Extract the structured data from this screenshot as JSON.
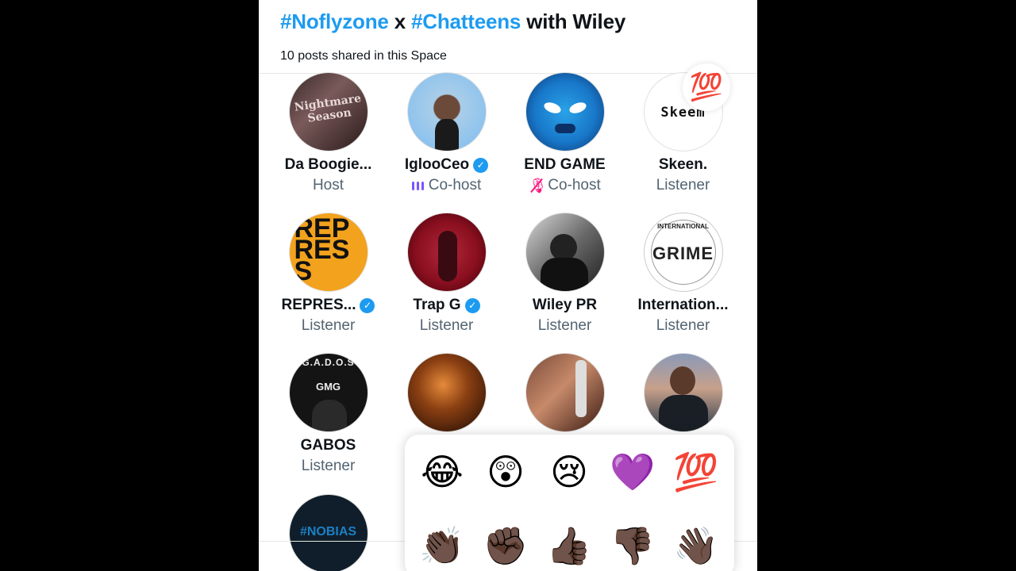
{
  "space": {
    "title_parts": [
      "#Noflyzone",
      " x ",
      "#Chatteens",
      " with Wiley"
    ],
    "subtitle": "10 posts shared in this Space"
  },
  "participants": [
    {
      "name": "Da Boogie...",
      "role": "Host",
      "verified": false,
      "avatar_text": "Nightmare Season"
    },
    {
      "name": "IglooCeo",
      "role": "Co-host",
      "verified": true,
      "status": "speaking"
    },
    {
      "name": "END GAME",
      "role": "Co-host",
      "verified": false,
      "status": "muted"
    },
    {
      "name": "Skeen.",
      "role": "Listener",
      "verified": false,
      "avatar_text": "Skeem"
    },
    {
      "name": "REPRES...",
      "role": "Listener",
      "verified": true,
      "avatar_text": "REP RES S"
    },
    {
      "name": "Trap G",
      "role": "Listener",
      "verified": true
    },
    {
      "name": "Wiley PR",
      "role": "Listener",
      "verified": false
    },
    {
      "name": "Internation...",
      "role": "Listener",
      "verified": false,
      "avatar_text": "GRIME",
      "avatar_subtext": "INTERNATIONAL"
    },
    {
      "name": "GABOS",
      "role": "Listener",
      "verified": false,
      "avatar_text": "G.A.D.O.S",
      "avatar_subtext": "GMG"
    },
    {
      "name": "",
      "role": "",
      "verified": false
    },
    {
      "name": "",
      "role": "",
      "verified": false
    },
    {
      "name": "",
      "role": "",
      "verified": false
    },
    {
      "name": "",
      "role": "",
      "verified": false,
      "avatar_text": "#NOBIAS"
    }
  ],
  "floating_reaction": "💯",
  "reactions": {
    "row1": [
      "😂",
      "😲",
      "😢",
      "💜",
      "💯"
    ],
    "row2": [
      "👏🏿",
      "✊🏿",
      "👍🏿",
      "👎🏿",
      "👋🏿"
    ]
  },
  "colors": {
    "accent": "#1d9bf0",
    "speaking": "#7856ff",
    "muted": "#f91880",
    "text_primary": "#0f1419",
    "text_secondary": "#536471"
  }
}
